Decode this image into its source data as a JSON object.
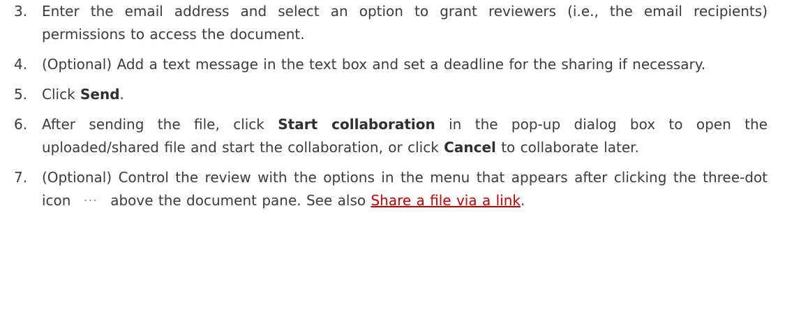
{
  "steps": [
    {
      "number": "3.",
      "text": "Enter the email address and select an option to grant reviewers (i.e., the email recipients) permissions to access the document."
    },
    {
      "number": "4.",
      "text": "(Optional) Add a text message in the text box and set a deadline for the sharing if necessary."
    },
    {
      "number": "5.",
      "prefix": "Click ",
      "bold": "Send",
      "suffix": "."
    },
    {
      "number": "6.",
      "prefix": "After sending the file, click ",
      "bold1": "Start collaboration",
      "middle": " in the pop-up dialog box to open the uploaded/shared file and start the collaboration, or click ",
      "bold2": "Cancel",
      "suffix": " to collaborate later."
    },
    {
      "number": "7.",
      "prefix": "(Optional) Control the review with the options in the menu that appears after clicking the three-dot icon",
      "icon": "more-horizontal-icon",
      "icon_glyph": "···",
      "middle": "above the document pane. See also ",
      "link": "Share a file via a link",
      "suffix": "."
    }
  ],
  "colors": {
    "text": "#3b3b3b",
    "link": "#c00000",
    "icon": "#888888"
  }
}
